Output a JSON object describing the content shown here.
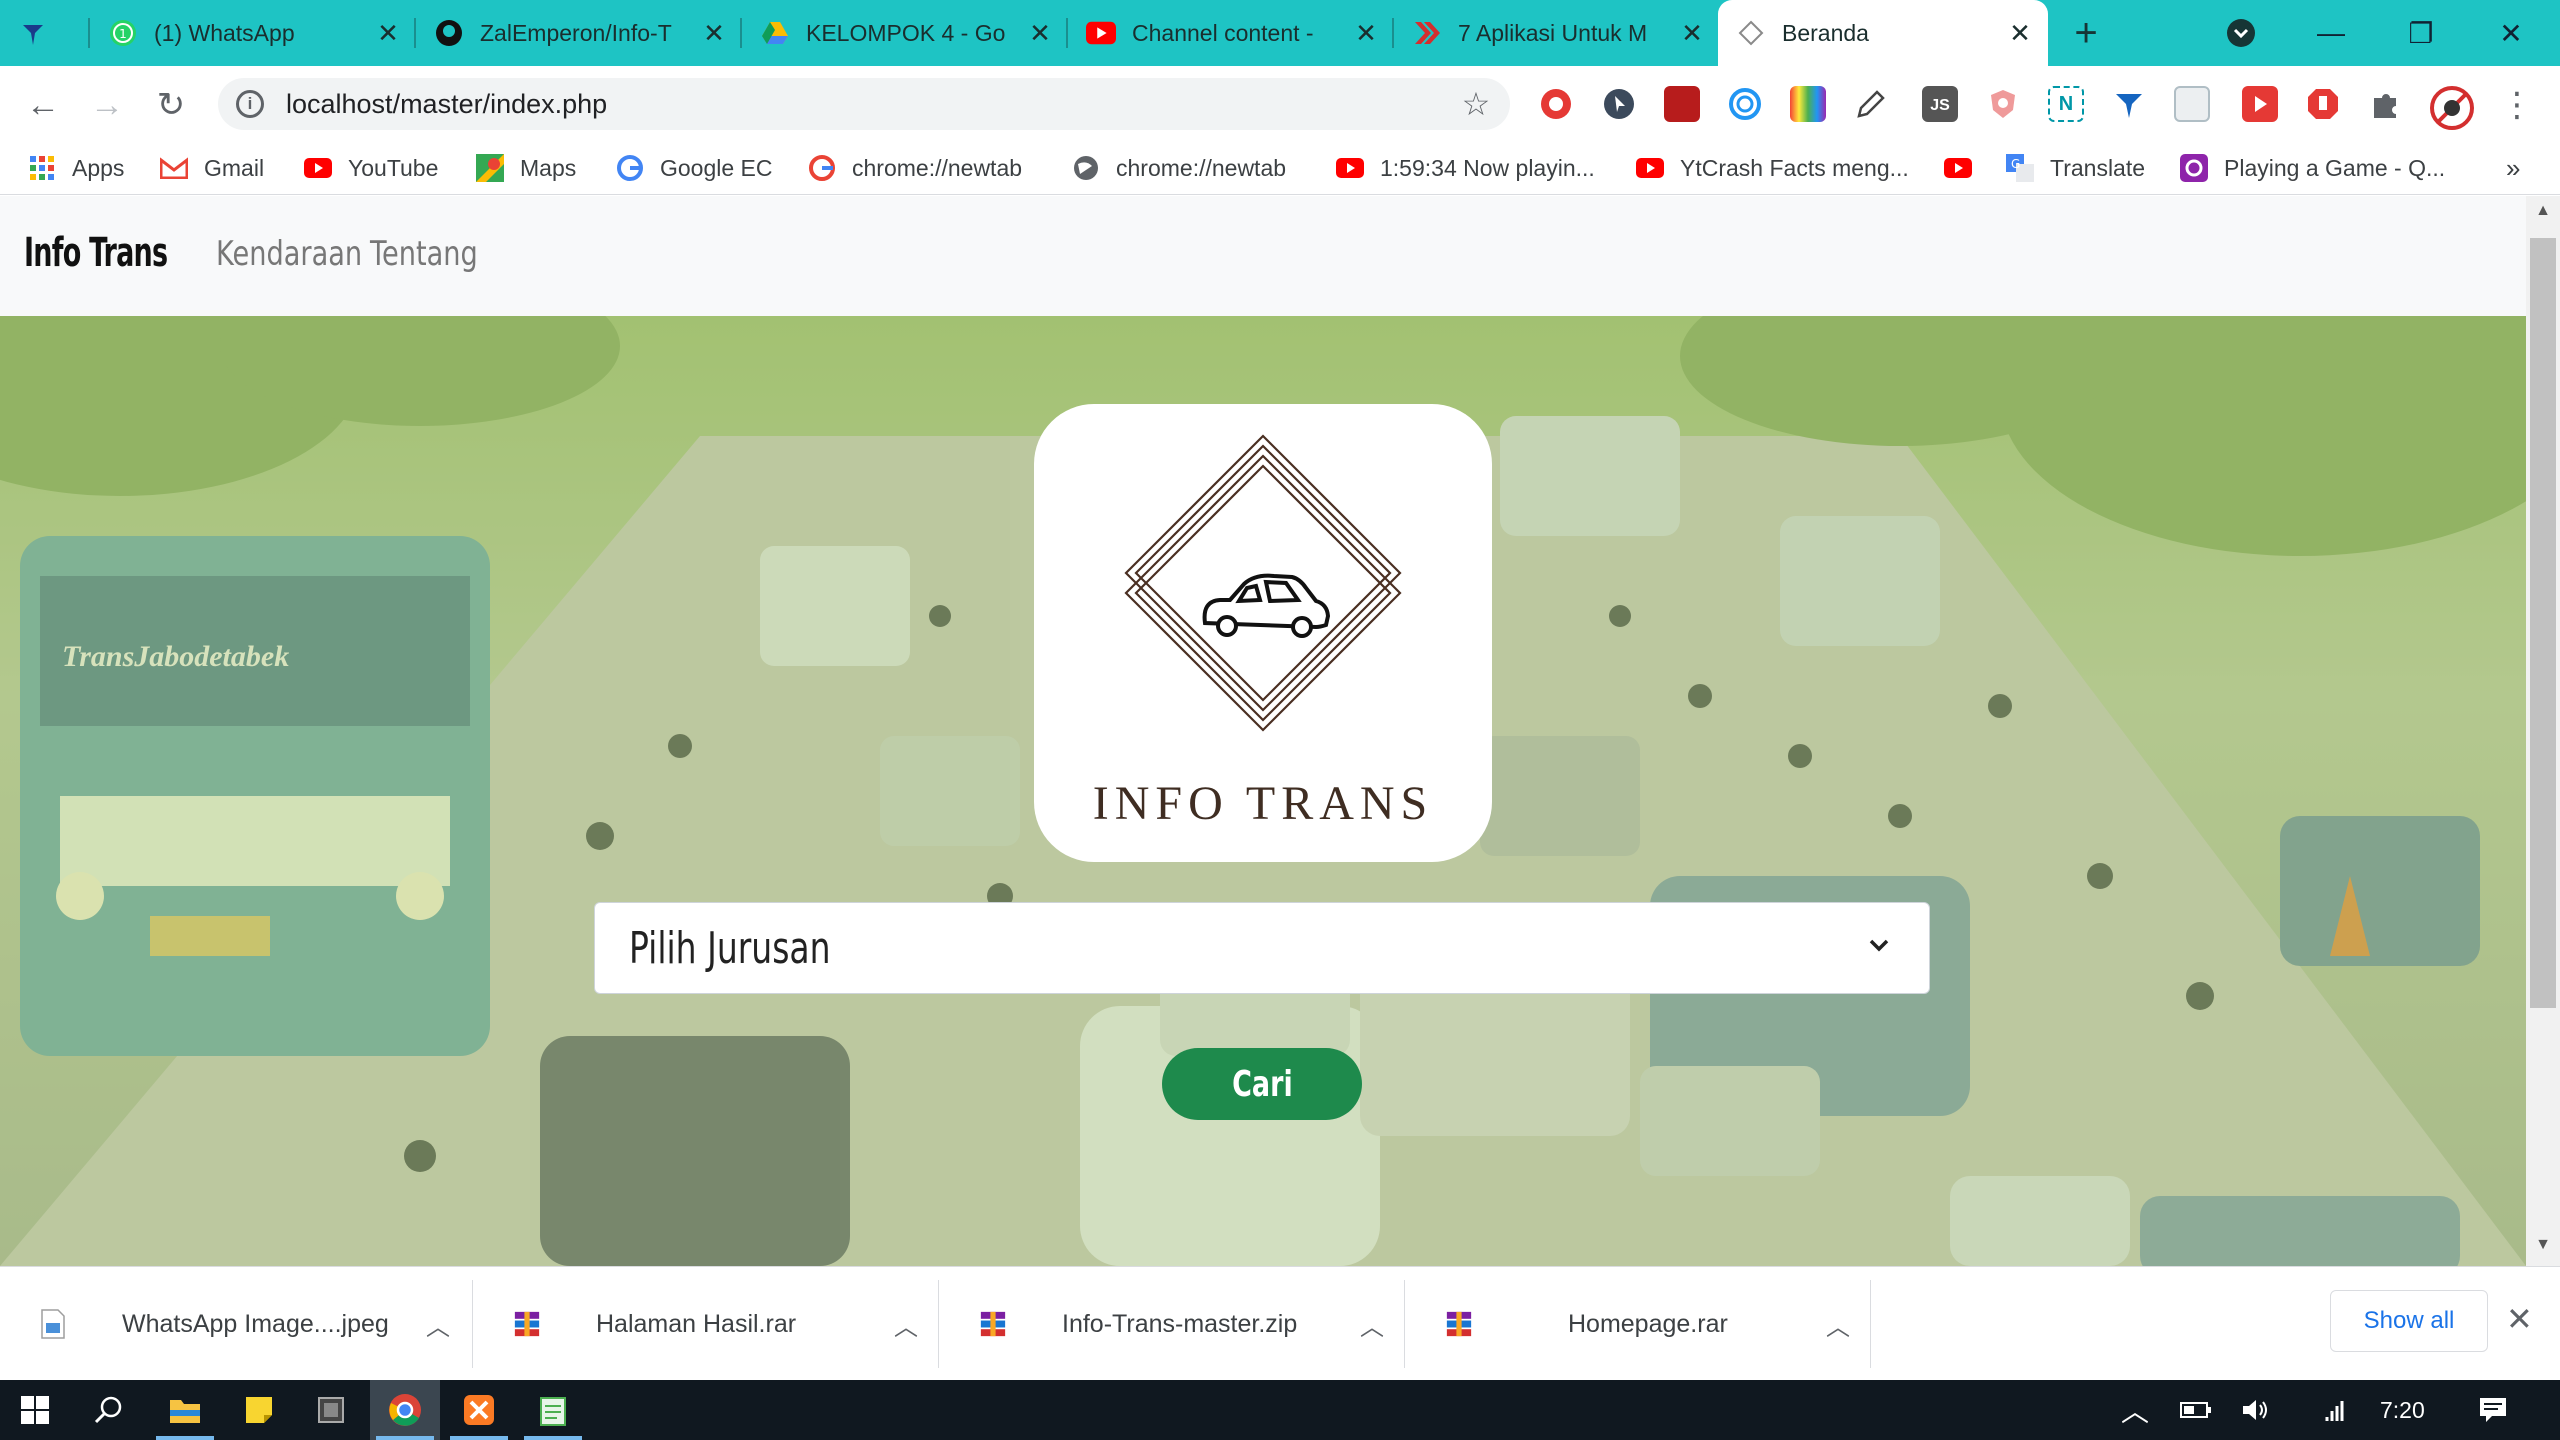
{
  "browser": {
    "tabs": [
      {
        "title": "",
        "icon": "pin-icon"
      },
      {
        "title": "(1) WhatsApp",
        "icon": "whatsapp-icon"
      },
      {
        "title": "ZalEmperon/Info-T",
        "icon": "github-icon"
      },
      {
        "title": "KELOMPOK 4 - Go",
        "icon": "drive-icon"
      },
      {
        "title": "Channel content -",
        "icon": "youtube-icon"
      },
      {
        "title": "7 Aplikasi Untuk M",
        "icon": "arrow-logo-icon"
      },
      {
        "title": "Beranda",
        "icon": "page-icon"
      }
    ],
    "url": "localhost/master/index.php",
    "bookmarks": [
      {
        "label": "Apps",
        "icon": "apps-grid-icon"
      },
      {
        "label": "Gmail",
        "icon": "gmail-icon"
      },
      {
        "label": "YouTube",
        "icon": "youtube-icon"
      },
      {
        "label": "Maps",
        "icon": "maps-icon"
      },
      {
        "label": "Google EC",
        "icon": "google-icon"
      },
      {
        "label": "chrome://newtab",
        "icon": "google-icon"
      },
      {
        "label": "chrome://newtab",
        "icon": "globe-icon"
      },
      {
        "label": "1:59:34 Now playin...",
        "icon": "youtube-icon"
      },
      {
        "label": "YtCrash Facts meng...",
        "icon": "youtube-icon"
      },
      {
        "label": "",
        "icon": "youtube-icon"
      },
      {
        "label": "Translate",
        "icon": "translate-icon"
      },
      {
        "label": "Playing a Game - Q...",
        "icon": "quizizz-icon"
      }
    ],
    "more_bookmarks": "»"
  },
  "site": {
    "brand": "Info Trans",
    "nav": [
      "Kendaraan",
      "Tentang"
    ],
    "logo_text": "INFO TRANS",
    "select_value": "Pilih Jurusan",
    "search_button": "Cari"
  },
  "downloads": {
    "items": [
      {
        "name": "WhatsApp Image....jpeg"
      },
      {
        "name": "Halaman Hasil.rar"
      },
      {
        "name": "Info-Trans-master.zip"
      },
      {
        "name": "Homepage.rar"
      }
    ],
    "show_all": "Show all"
  },
  "taskbar": {
    "time": "7:20"
  },
  "colors": {
    "tabstrip": "#1ec4c4",
    "cari_button": "#1e8a4c",
    "hero_tint": "#b7c69a"
  }
}
